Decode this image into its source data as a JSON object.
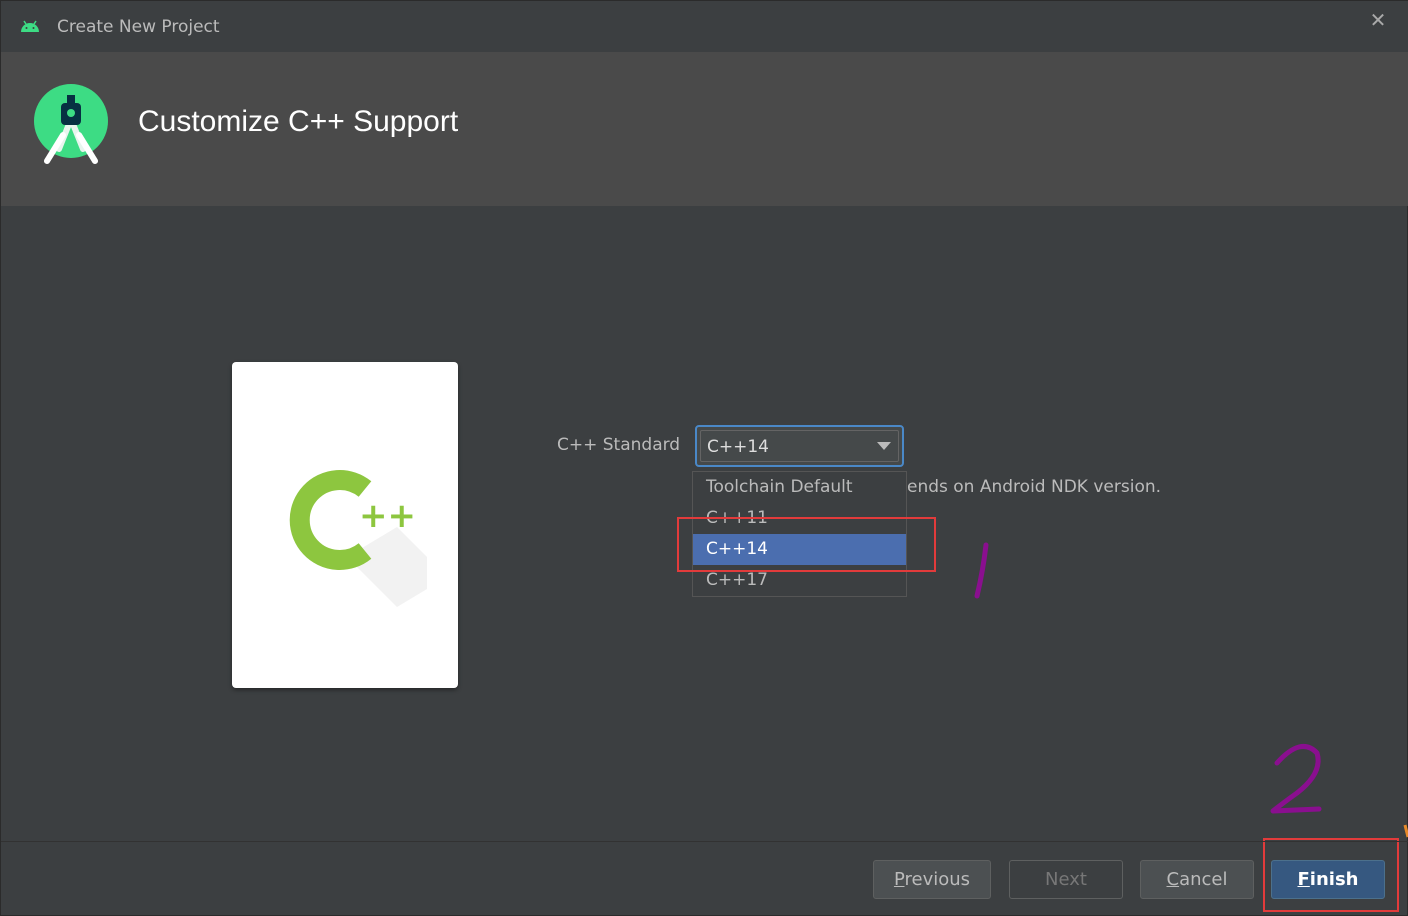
{
  "window": {
    "title": "Create New Project",
    "close_glyph": "✕"
  },
  "header": {
    "title": "Customize C++ Support"
  },
  "card": {
    "image_text": "++"
  },
  "form": {
    "label": "C++ Standard",
    "selected": "C++14",
    "hint": "ends on Android NDK version.",
    "options": [
      "Toolchain Default",
      "C++11",
      "C++14",
      "C++17"
    ],
    "selected_index": 2
  },
  "buttons": {
    "previous": {
      "mnemonic": "P",
      "rest": "revious"
    },
    "next": "Next",
    "cancel": {
      "mnemonic": "C",
      "rest": "ancel"
    },
    "finish": {
      "mnemonic": "F",
      "rest": "inish"
    }
  },
  "annotations": {
    "mark1": "1",
    "mark2": "2"
  },
  "colors": {
    "accent": "#4b6eaf",
    "annotation_red": "#e23b3b",
    "annotation_purple": "#8a0f8f",
    "android_green": "#3ddc84",
    "cpp_green": "#8dc63f"
  },
  "icons": {
    "title": "android-icon",
    "logo": "android-studio-logo-icon",
    "card": "cpp-logo-icon",
    "arrow": "chevron-down-icon"
  }
}
